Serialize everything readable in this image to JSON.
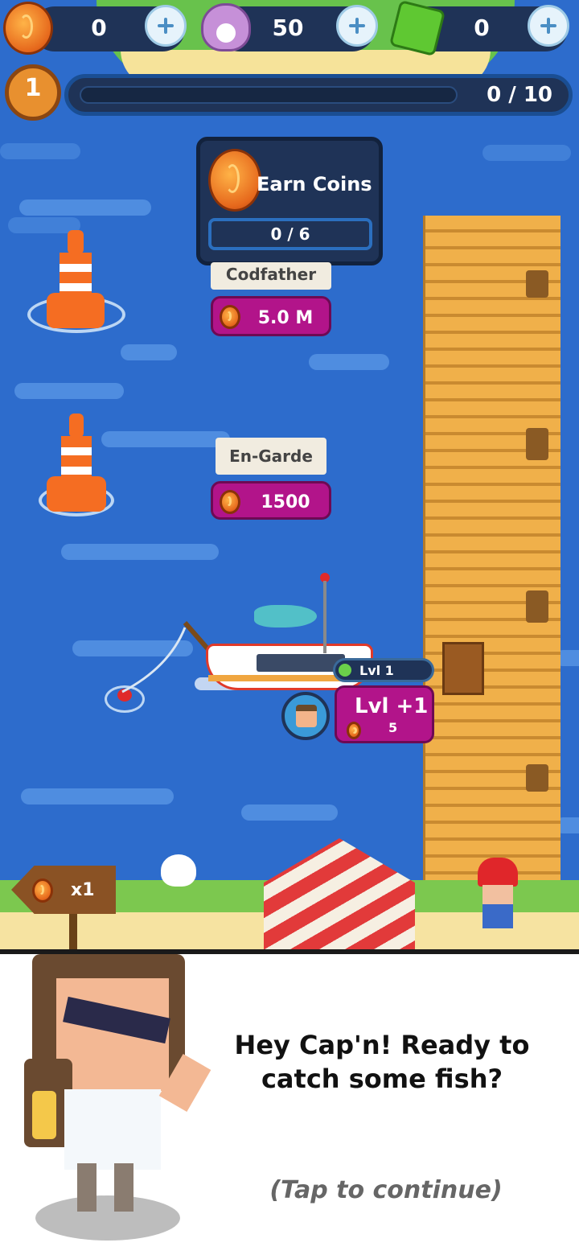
{
  "resources": {
    "coins": "0",
    "pearls": "50",
    "gems": "0"
  },
  "level": {
    "number": "1",
    "progress": "0 / 10",
    "progress_fraction": 0
  },
  "quest": {
    "title": "Earn Coins",
    "progress": "0 / 6"
  },
  "fishing_spots": [
    {
      "name": "Codfather",
      "price": "5.0 M"
    },
    {
      "name": "En-Garde",
      "price": "1500"
    }
  ],
  "boat": {
    "level_label": "Lvl 1",
    "upgrade_label": "Lvl +1",
    "upgrade_cost": "5"
  },
  "multiplier": {
    "label": "x1"
  },
  "dialog": {
    "message": "Hey Cap'n! Ready to catch some fish?",
    "hint": "(Tap to continue)"
  }
}
